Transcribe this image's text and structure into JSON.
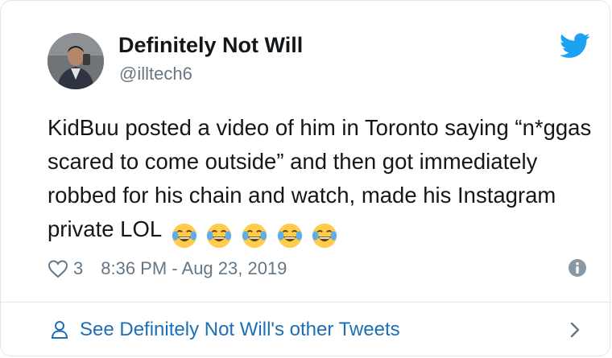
{
  "author": {
    "display_name": "Definitely Not Will",
    "handle": "@illtech6",
    "avatar_icon": "profile-photo"
  },
  "tweet": {
    "text": "KidBuu posted a video of him in Toronto saying “n*ggas scared to come outside” and then got immediately robbed for his chain and watch, made his Instagram private LOL",
    "emoji_icon": "face-with-tears-of-joy",
    "emoji_count": 5
  },
  "meta": {
    "like_count": "3",
    "timestamp": "8:36 PM - Aug 23, 2019"
  },
  "footer": {
    "link_text": "See Definitely Not Will's other Tweets"
  },
  "colors": {
    "twitter_blue": "#1da1f2",
    "link_blue": "#1b6fb6",
    "secondary_text": "#657786",
    "border": "#e1e8ed"
  }
}
